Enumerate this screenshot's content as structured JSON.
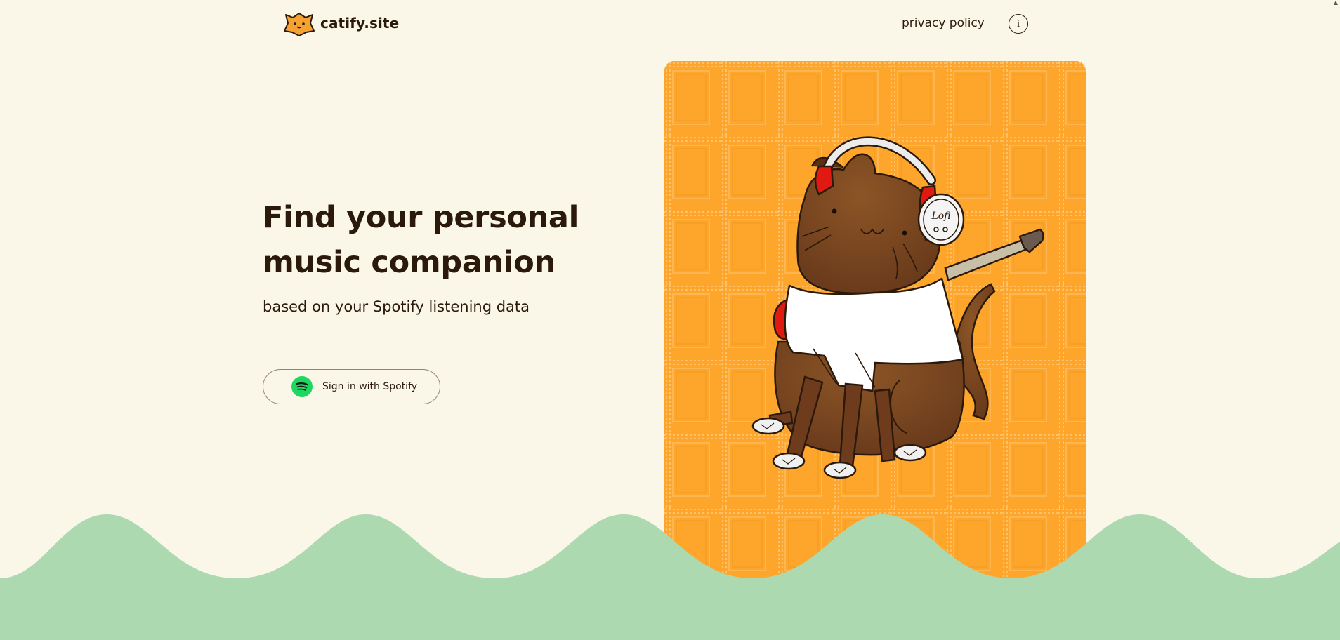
{
  "header": {
    "brand_name": "catify.site",
    "privacy_label": "privacy policy",
    "info_label": "i"
  },
  "hero": {
    "title": "Find your personal music companion",
    "subtitle": "based on your Spotify listening data",
    "signin_label": "Sign in with Spotify"
  },
  "illustration": {
    "headphone_text": "Lofi"
  },
  "icons": {
    "brand_logo": "cat-star-icon",
    "info": "info-icon",
    "spotify": "spotify-icon",
    "scroll": "scroll-up-arrow-icon"
  },
  "colors": {
    "background": "#faf7e9",
    "text": "#2b1a0c",
    "card_orange": "#fea62b",
    "wave_green": "#acd9af",
    "spotify_green": "#1ed760",
    "cat_brown": "#7a4320"
  }
}
